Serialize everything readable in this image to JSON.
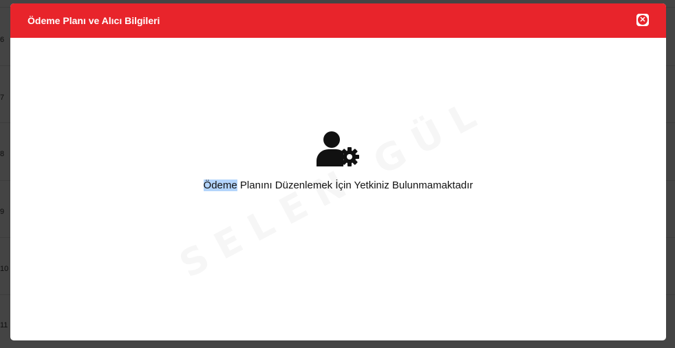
{
  "background": {
    "row_numbers": [
      "6",
      "7",
      "8",
      "9",
      "10",
      "11"
    ]
  },
  "modal": {
    "title": "Ödeme Planı ve Alıcı Bilgileri",
    "close_icon": "close-circle-icon",
    "body_icon": "user-gear-icon",
    "message_selected": "Ödeme",
    "message_rest": " Planını Düzenlemek İçin Yetkiniz Bulunmamaktadır",
    "watermark": "SELEN GÜL"
  },
  "colors": {
    "header": "#e8242b",
    "selection": "#b3d4fb",
    "text": "#111111"
  }
}
